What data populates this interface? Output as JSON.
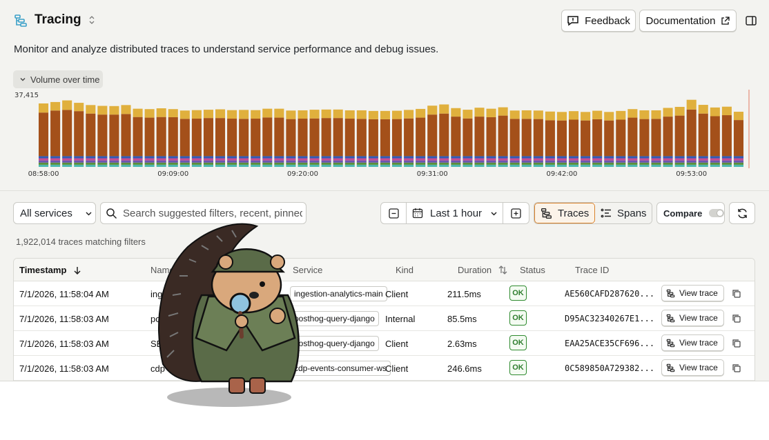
{
  "header": {
    "title": "Tracing",
    "feedback_label": "Feedback",
    "docs_label": "Documentation",
    "description": "Monitor and analyze distributed traces to understand service performance and debug issues."
  },
  "volume": {
    "toggle_label": "Volume over time"
  },
  "chart_data": {
    "type": "bar",
    "stacked": true,
    "y_max_label": "37,415",
    "ylim": [
      0,
      37415
    ],
    "x_tick_labels": [
      "08:58:00",
      "09:09:00",
      "09:20:00",
      "09:31:00",
      "09:42:00",
      "09:53:00"
    ],
    "colors": {
      "primary": "#a4501a",
      "secondary": "#e0b03d",
      "accent1": "#4cb8b0",
      "accent2": "#5a8f3a",
      "accent3": "#6a55b0",
      "accent4": "#c64b8f",
      "accent5": "#2f5bb8"
    },
    "series": [
      {
        "name": "",
        "values": [
          21500,
          22500,
          22800,
          22200,
          21000,
          20500,
          20500,
          20800,
          19300,
          19000,
          19300,
          19200,
          18400,
          18500,
          18800,
          18800,
          18500,
          18400,
          18500,
          19100,
          19000,
          18300,
          18500,
          18600,
          18800,
          18800,
          18500,
          18400,
          18200,
          18200,
          18300,
          18600,
          19000,
          20500,
          21000,
          19500,
          18600,
          19500,
          19200,
          20000,
          18400,
          18400,
          18300,
          17700,
          17600,
          18000,
          17600,
          18200,
          17600,
          18000,
          19000,
          18300,
          18400,
          19500,
          20000,
          23000,
          21000,
          19700,
          20200,
          17800
        ]
      },
      {
        "name": "",
        "values": [
          4500,
          4200,
          4700,
          4100,
          4200,
          4300,
          4200,
          4400,
          4100,
          4200,
          4300,
          4000,
          4100,
          4200,
          4100,
          4300,
          4200,
          4400,
          4200,
          4300,
          4400,
          4200,
          4100,
          4300,
          4200,
          4200,
          4100,
          4200,
          4100,
          4100,
          4100,
          4200,
          4300,
          4400,
          4500,
          4200,
          4300,
          4400,
          4200,
          4100,
          4100,
          4200,
          4200,
          4300,
          4200,
          4200,
          4200,
          4200,
          4200,
          4300,
          4200,
          4300,
          4200,
          4300,
          4300,
          4800,
          4300,
          4300,
          4200,
          4100
        ]
      },
      {
        "name": "",
        "values": [
          5300,
          5300,
          5300,
          5300,
          5300,
          5300,
          5300,
          5300,
          5300,
          5300,
          5300,
          5300,
          5300,
          5300,
          5300,
          5300,
          5300,
          5300,
          5300,
          5300,
          5300,
          5300,
          5300,
          5300,
          5300,
          5300,
          5300,
          5300,
          5300,
          5300,
          5300,
          5300,
          5300,
          5300,
          5300,
          5300,
          5300,
          5300,
          5300,
          5300,
          5300,
          5300,
          5300,
          5300,
          5300,
          5300,
          5300,
          5300,
          5300,
          5300,
          5300,
          5300,
          5300,
          5300,
          5300,
          5300,
          5300,
          5300,
          5300,
          5300
        ]
      }
    ]
  },
  "filters": {
    "services_label": "All services",
    "search_placeholder": "Search suggested filters, recent, pinned, or use a filter",
    "range_label": "Last 1 hour",
    "traces_tab": "Traces",
    "spans_tab": "Spans",
    "compare_label": "Compare",
    "count_text": "1,922,014 traces matching filters"
  },
  "table": {
    "headers": {
      "timestamp": "Timestamp",
      "name": "Name",
      "service": "Service",
      "kind": "Kind",
      "duration": "Duration",
      "status": "Status",
      "trace_id": "Trace ID"
    },
    "view_trace_label": "View trace",
    "rows": [
      {
        "timestamp": "7/1/2026, 11:58:04 AM",
        "name": "inges",
        "service": "ingestion-analytics-main",
        "kind": "Client",
        "duration": "211.5ms",
        "status": "OK",
        "trace_id": "AE560CAFD287620..."
      },
      {
        "timestamp": "7/1/2026, 11:58:03 AM",
        "name": "pos",
        "service": "posthog-query-django",
        "kind": "Internal",
        "duration": "85.5ms",
        "status": "OK",
        "trace_id": "D95AC32340267E1..."
      },
      {
        "timestamp": "7/1/2026, 11:58:03 AM",
        "name": "SE",
        "service": "posthog-query-django",
        "kind": "Client",
        "duration": "2.63ms",
        "status": "OK",
        "trace_id": "EAA25ACE35CF696..."
      },
      {
        "timestamp": "7/1/2026, 11:58:03 AM",
        "name": "cdp",
        "service": "cdp-events-consumer-ws",
        "kind": "Client",
        "duration": "246.6ms",
        "status": "OK",
        "trace_id": "0C589850A729382..."
      }
    ]
  }
}
